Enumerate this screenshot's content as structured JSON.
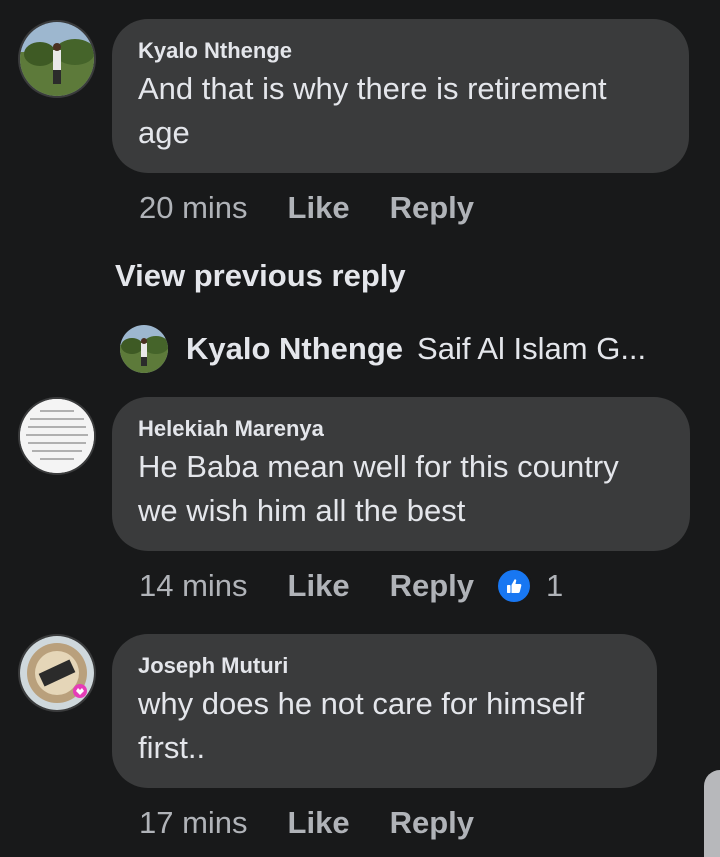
{
  "comments": [
    {
      "author": "Kyalo Nthenge",
      "text": "And that is why there is retirement age",
      "time": "20 mins",
      "like_label": "Like",
      "reply_label": "Reply",
      "avatar": "landscape-photo-avatar"
    },
    {
      "author": "Helekiah Marenya",
      "text": "He Baba mean well for this country we wish him all the best",
      "time": "14 mins",
      "like_label": "Like",
      "reply_label": "Reply",
      "reaction_count": "1",
      "avatar": "text-note-avatar"
    },
    {
      "author": "Joseph Muturi",
      "text": "why does he not care for himself first..",
      "time": "17 mins",
      "like_label": "Like",
      "reply_label": "Reply",
      "avatar": "vaccine-frame-avatar"
    }
  ],
  "view_previous_reply": "View previous reply",
  "reply_preview": {
    "name": "Kyalo Nthenge",
    "snippet": "Saif Al Islam G..."
  },
  "colors": {
    "background": "#18191a",
    "bubble": "#3a3b3c",
    "text": "#e4e6eb",
    "muted": "#b0b3b8",
    "like_blue": "#1877f2"
  }
}
